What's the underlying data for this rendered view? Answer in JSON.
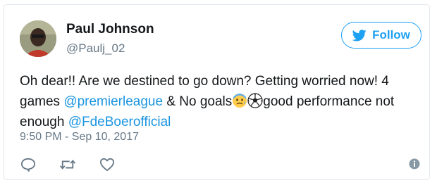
{
  "author": {
    "name": "Paul Johnson",
    "handle": "@Paulj_02"
  },
  "follow_label": "Follow",
  "tweet": {
    "t1": "Oh dear!! Are we destined to go down? Getting worried now! 4 games ",
    "mention1": "@premierleague",
    "t2": " & No goals",
    "t3": "good performance not enough ",
    "mention2": "@FdeBoerofficial"
  },
  "timestamp": "9:50 PM - Sep 10, 2017",
  "icons": {
    "reply": "reply-icon",
    "retweet": "retweet-icon",
    "like": "heart-icon",
    "info": "info-icon",
    "emoji1": "worried-face-emoji",
    "emoji2": "soccer-ball-emoji",
    "follow": "twitter-bird-icon"
  },
  "colors": {
    "accent": "#1da1f2",
    "link": "#1b95e0",
    "text": "#14171a",
    "muted": "#657786"
  }
}
